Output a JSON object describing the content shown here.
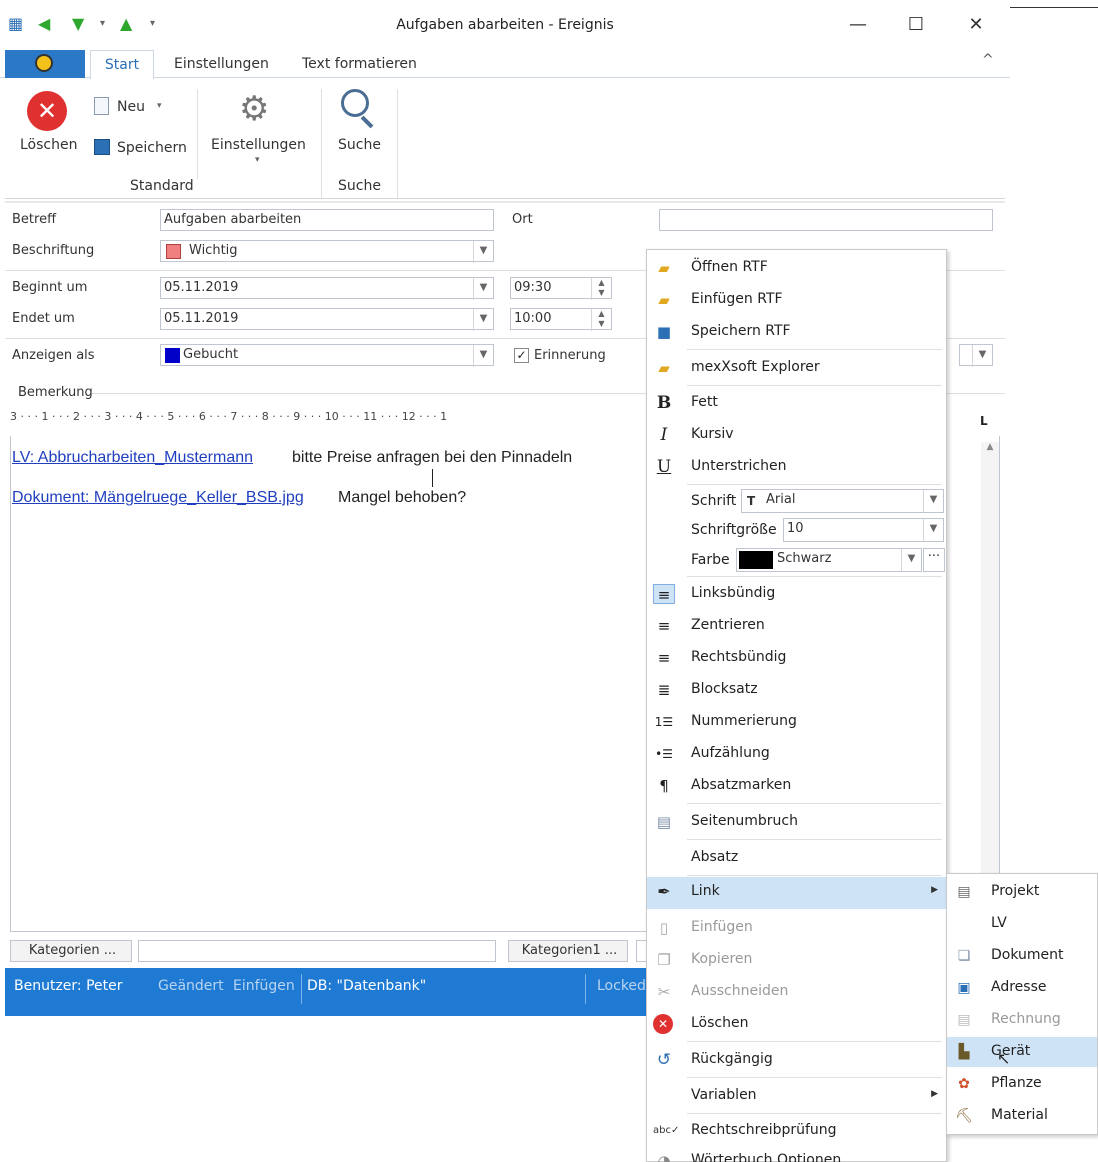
{
  "window": {
    "title": "Aufgaben abarbeiten - Ereignis",
    "minimize": "—",
    "maximize": "☐",
    "close": "✕"
  },
  "tabs": {
    "start": "Start",
    "settings": "Einstellungen",
    "format": "Text formatieren",
    "collapse": "^"
  },
  "ribbon": {
    "delete": "Löschen",
    "new": "Neu",
    "save": "Speichern",
    "settings": "Einstellungen",
    "search": "Suche",
    "group_standard": "Standard",
    "group_search": "Suche"
  },
  "form": {
    "subject_label": "Betreff",
    "subject_value": "Aufgaben abarbeiten",
    "location_label": "Ort",
    "location_value": "",
    "label_label": "Beschriftung",
    "label_value": "Wichtig",
    "start_label": "Beginnt um",
    "start_date": "05.11.2019",
    "start_time": "09:30",
    "end_label": "Endet um",
    "end_date": "05.11.2019",
    "end_time": "10:00",
    "show_as_label": "Anzeigen als",
    "show_as_value": "Gebucht",
    "reminder_label": "Erinnerung",
    "remark_label": "Bemerkung"
  },
  "ruler": "3 · · · 1 · · · 2 · · · 3 · · · 4 · · · 5 · · · 6 · · · 7 · · · 8 · · · 9 · · · 10 · · · 11 · · · 12 · · · 1",
  "editor": {
    "link1": "LV: Abbrucharbeiten_Mustermann",
    "text1": "bitte Preise anfragen bei den Pinnadeln",
    "link2": "Dokument: Mängelruege_Keller_BSB.jpg",
    "text2": "Mangel behoben?"
  },
  "bottom": {
    "categories": "Kategorien ...",
    "categories1": "Kategorien1 ..."
  },
  "status": {
    "user": "Benutzer: Peter",
    "changed": "Geändert",
    "insert": "Einfügen",
    "db": "DB: \"Datenbank\"",
    "locked": "Locked"
  },
  "menu": {
    "open_rtf": "Öffnen RTF",
    "insert_rtf": "Einfügen RTF",
    "save_rtf": "Speichern RTF",
    "explorer": "mexXsoft Explorer",
    "bold": "Fett",
    "italic": "Kursiv",
    "underline": "Unterstrichen",
    "font_label": "Schrift",
    "font_value": "Arial",
    "size_label": "Schriftgröße",
    "size_value": "10",
    "color_label": "Farbe",
    "color_value": "Schwarz",
    "align_left": "Linksbündig",
    "center": "Zentrieren",
    "align_right": "Rechtsbündig",
    "justify": "Blocksatz",
    "numbering": "Nummerierung",
    "bullets": "Aufzählung",
    "paragraph_marks": "Absatzmarken",
    "page_break": "Seitenumbruch",
    "paragraph": "Absatz",
    "link": "Link",
    "paste": "Einfügen",
    "copy": "Kopieren",
    "cut": "Ausschneiden",
    "delete": "Löschen",
    "undo": "Rückgängig",
    "variables": "Variablen",
    "spellcheck": "Rechtschreibprüfung",
    "dictionary": "Wörterbuch Optionen"
  },
  "submenu": {
    "project": "Projekt",
    "lv": "LV",
    "document": "Dokument",
    "address": "Adresse",
    "invoice": "Rechnung",
    "device": "Gerät",
    "plant": "Pflanze",
    "material": "Material"
  },
  "colors": {
    "accent": "#1f7ad3",
    "label_wichtig": "#f08080",
    "gebucht": "#0000c8",
    "hover": "#cfe3f7"
  }
}
